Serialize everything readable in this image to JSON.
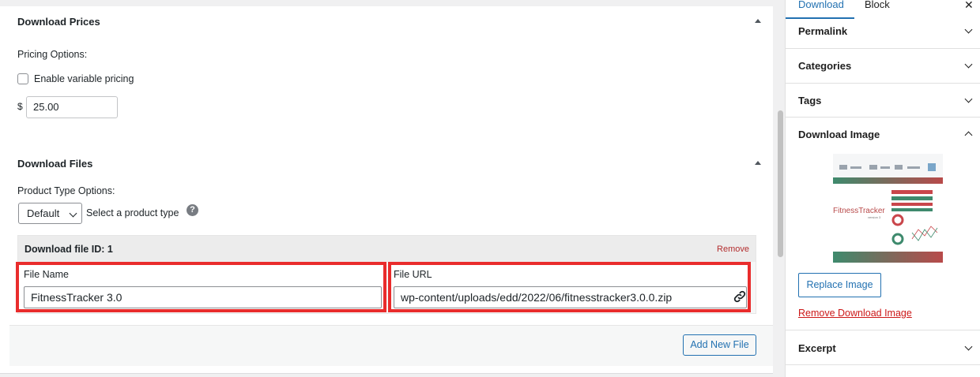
{
  "prices": {
    "title": "Download Prices",
    "pricing_options_label": "Pricing Options:",
    "variable_pricing_label": "Enable variable pricing",
    "variable_pricing_checked": false,
    "currency_symbol": "$",
    "price_value": "25.00"
  },
  "files": {
    "title": "Download Files",
    "product_type_label": "Product Type Options:",
    "product_type_selected": "Default",
    "select_hint": "Select a product type",
    "help_glyph": "?",
    "file_id_label": "Download file ID: 1",
    "remove_label": "Remove",
    "file_name_label": "File Name",
    "file_name_value": "FitnessTracker 3.0",
    "file_url_label": "File URL",
    "file_url_value": "wp-content/uploads/edd/2022/06/fitnesstracker3.0.0.zip",
    "add_new_label": "Add New File"
  },
  "sidebar": {
    "tabs": [
      "Download",
      "Block"
    ],
    "active_tab": "Download",
    "close_glyph": "✕",
    "panels": {
      "permalink": "Permalink",
      "categories": "Categories",
      "tags": "Tags",
      "download_image": "Download Image",
      "excerpt": "Excerpt"
    },
    "image_thumb": {
      "brand_line": "FitnessTracker",
      "version_line": "version 3"
    },
    "replace_image_label": "Replace Image",
    "remove_image_label": "Remove Download Image"
  },
  "colors": {
    "accent": "#2271b1",
    "highlight": "#e92c2c",
    "danger": "#b32d2e"
  }
}
